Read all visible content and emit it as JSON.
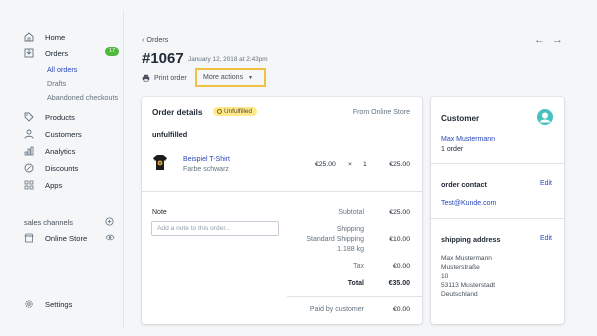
{
  "sidebar": {
    "items": [
      {
        "label": "Home",
        "icon": "home-icon"
      },
      {
        "label": "Orders",
        "icon": "orders-icon",
        "badge": "17"
      },
      {
        "label": "Products",
        "icon": "tag-icon"
      },
      {
        "label": "Customers",
        "icon": "person-icon"
      },
      {
        "label": "Analytics",
        "icon": "bar-chart-icon"
      },
      {
        "label": "Discounts",
        "icon": "discount-icon"
      },
      {
        "label": "Apps",
        "icon": "apps-icon"
      }
    ],
    "order_subitems": [
      "All orders",
      "Drafts",
      "Abandoned checkouts"
    ],
    "sales_channels_label": "sales channels",
    "online_store_label": "Online Store",
    "settings_label": "Settings"
  },
  "header": {
    "back_label": "Orders",
    "order_number": "#1067",
    "order_date": "January 12, 2018 at 2:43pm",
    "print_label": "Print order",
    "more_actions_label": "More actions"
  },
  "order_details": {
    "title": "Order details",
    "status_badge": "Unfulfilled",
    "source": "From Online Store",
    "fulfillment_heading": "unfulfilled",
    "line_item": {
      "name": "Beispiel T-Shirt",
      "variant": "Farbe schwarz",
      "unit_price": "€25.00",
      "times": "×",
      "quantity": "1",
      "total": "€25.00"
    },
    "note_label": "Note",
    "note_placeholder": "Add a note to this order...",
    "summary": {
      "subtotal_label": "Subtotal",
      "subtotal_value": "€25.00",
      "shipping_label": "Shipping",
      "shipping_method": "Standard Shipping",
      "shipping_weight": "1.188 kg",
      "shipping_value": "€10.00",
      "tax_label": "Tax",
      "tax_value": "€0.00",
      "total_label": "Total",
      "total_value": "€35.00",
      "paid_label": "Paid by customer",
      "paid_value": "€0.00"
    }
  },
  "customer": {
    "title": "Customer",
    "name": "Max Mustermann",
    "orders": "1 order",
    "contact_title": "order contact",
    "contact_edit": "Edit",
    "email": "Test@Kunde.com",
    "shipping_title": "shipping address",
    "shipping_edit": "Edit",
    "address_lines": [
      "Max Mustermann",
      "Musterstraße",
      "10",
      "53113 Musterstadt",
      "Deutschland"
    ]
  },
  "colors": {
    "accent": "#2a47b8",
    "badge_green": "#50b83c",
    "status_yellow": "#ffea8a",
    "highlight_border": "#f0c142"
  }
}
